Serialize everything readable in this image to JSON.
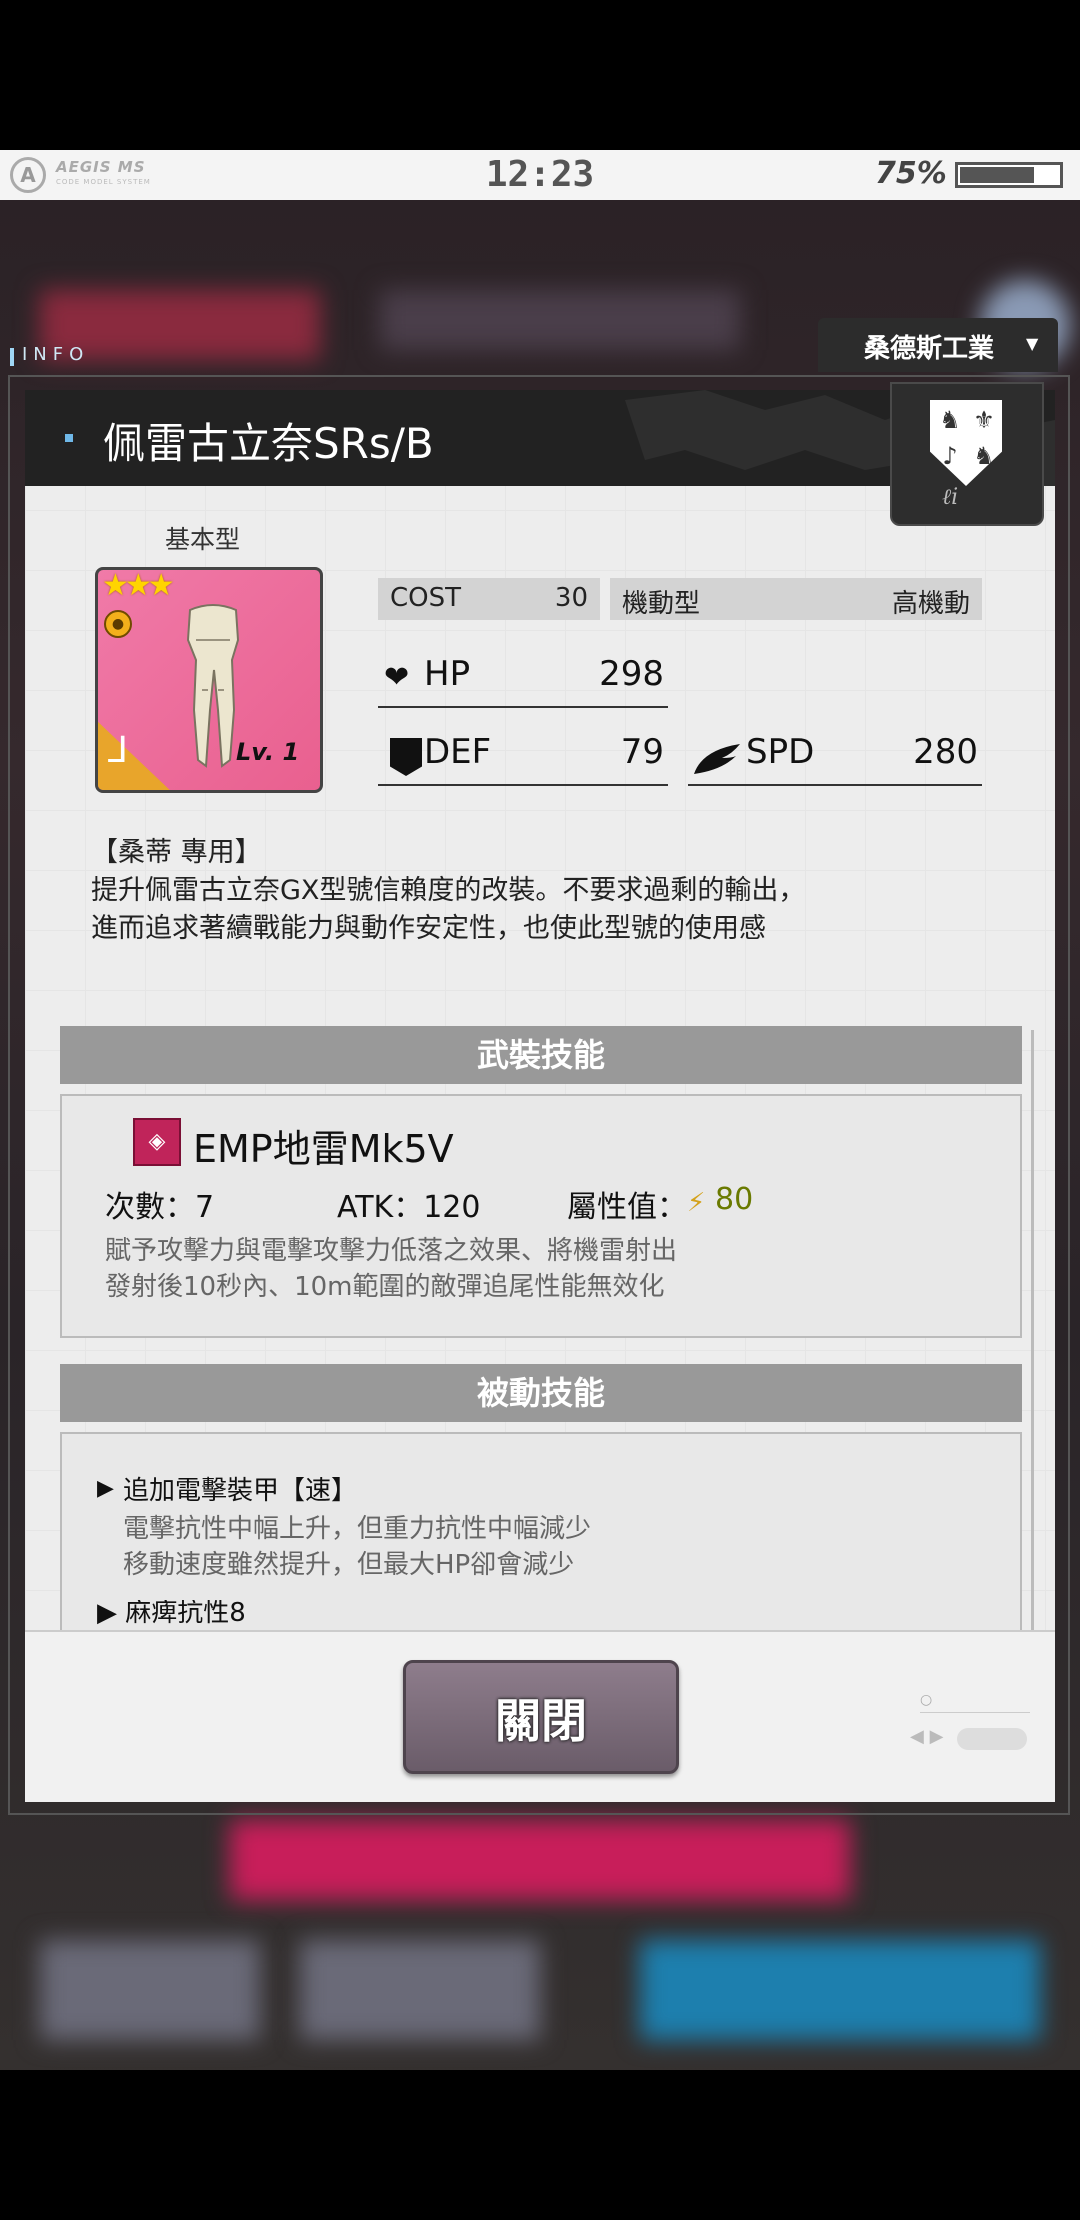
{
  "status_bar": {
    "logo_text": "AEGIS MS",
    "logo_sub": "CODE MODEL SYSTEM",
    "time": "12:23",
    "battery_percent": "75%",
    "battery_level": 0.75
  },
  "header": {
    "info_label": "INFO",
    "manufacturer": "桑德斯工業"
  },
  "part": {
    "title": "佩雷古立奈SRs/B",
    "type_label": "基本型",
    "stars": "★★★",
    "level": "Lv. 1",
    "cost_label": "COST",
    "cost_value": "30",
    "mobility_label": "機動型",
    "mobility_value": "高機動",
    "hp_label": "HP",
    "hp_value": "298",
    "def_label": "DEF",
    "def_value": "79",
    "spd_label": "SPD",
    "spd_value": "280"
  },
  "description": {
    "heading": "【桑蒂 專用】",
    "line1": "提升佩雷古立奈GX型號信賴度的改裝。不要求過剩的輸出，",
    "line2": "進而追求著續戰能力與動作安定性，也使此型號的使用感"
  },
  "weapon_skill": {
    "heading": "武裝技能",
    "name": "EMP地雷Mk5V",
    "count": "次數：7",
    "atk": "ATK：120",
    "attr_label": "屬性值：",
    "attr_value": "80",
    "desc1": "賦予攻擊力與電擊攻擊力低落之效果、將機雷射出",
    "desc2": "發射後10秒內、10m範圍的敵彈追尾性能無效化"
  },
  "passive_skill": {
    "heading": "被動技能",
    "name": "追加電擊裝甲【速】",
    "desc1": "電擊抗性中幅上升，但重力抗性中幅減少",
    "desc2": "移動速度雖然提升，但最大HP卻會減少",
    "next_partial": "▶ 麻痺抗性8"
  },
  "footer": {
    "close_label": "關閉"
  },
  "colors": {
    "title_bar": "#222222",
    "section_header": "#999999",
    "card_pink": "#f07aa8",
    "close_button": "#7d6e7b"
  }
}
